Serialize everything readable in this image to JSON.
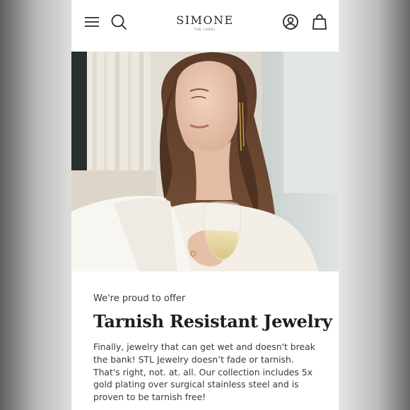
{
  "header": {
    "logo_text": "SIMONE",
    "logo_subtext": "THE LABEL",
    "menu_icon": "hamburger-menu-icon",
    "search_icon": "search-icon",
    "account_icon": "account-icon",
    "cart_icon": "shopping-bag-icon"
  },
  "hero": {
    "image_subject": "woman holding a glass of white wine wearing gold jewelry"
  },
  "promo": {
    "eyebrow": "We're proud to offer",
    "headline": "Tarnish Resistant Jewelry",
    "body": "Finally, jewelry that can get wet and doesn't break the bank!  STL Jewelry doesn’t fade or tarnish. That's right, not. at. all. Our collection includes 5x gold plating over surgical stainless steel and is proven to be tarnish free!"
  },
  "colors": {
    "page_bg": "#ffffff",
    "text_dark": "#1e1e1e",
    "text_body": "#3a3a3a"
  }
}
